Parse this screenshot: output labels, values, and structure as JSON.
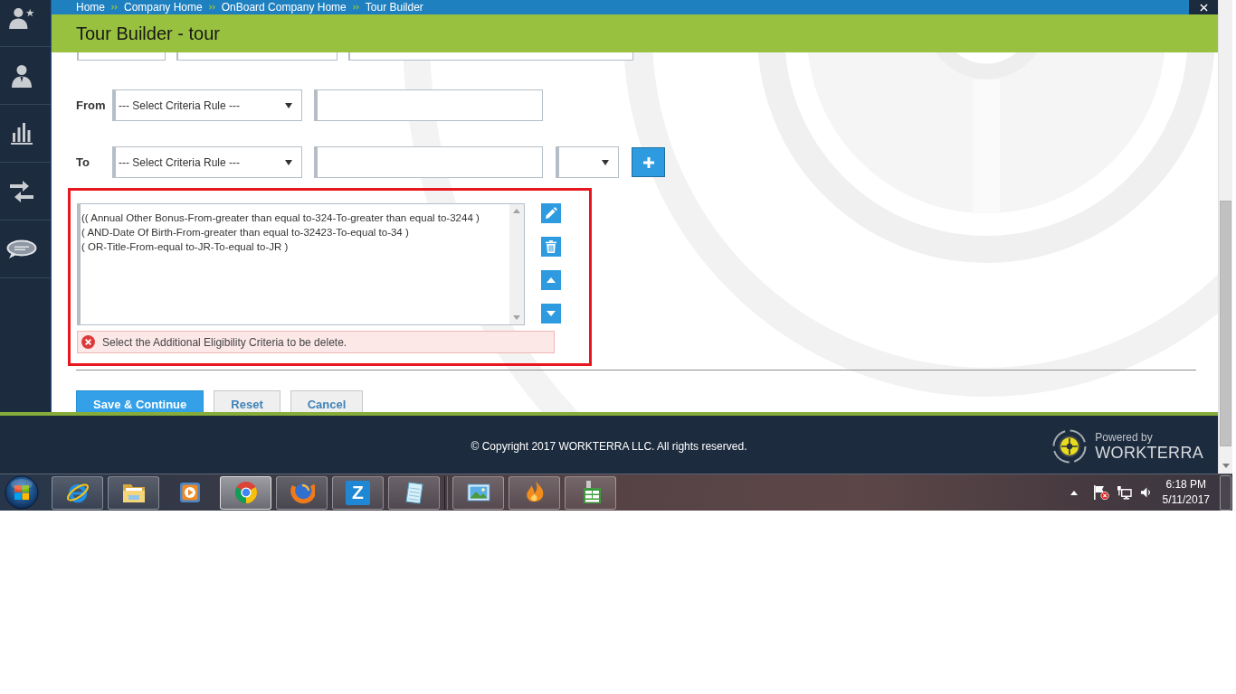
{
  "top_bar": {
    "breadcrumb": [
      "Home",
      "Company Home",
      "OnBoard Company Home",
      "Tour Builder"
    ]
  },
  "page_title": "Tour Builder - tour",
  "from_row": {
    "label": "From",
    "rule_select": "--- Select Criteria Rule ---"
  },
  "to_row": {
    "label": "To",
    "rule_select": "--- Select Criteria Rule ---"
  },
  "criteria_list": [
    {
      "text": "(( Annual Other Bonus-From-greater than equal to-324-To-greater than equal to-3244 )",
      "selected": false
    },
    {
      "text": "( AND-Date Of Birth-From-greater than equal to-32423-To-equal to-34 )",
      "selected": false
    },
    {
      "text": "( OR-Title-From-equal to-JR-To-equal to-JR )",
      "selected": false
    }
  ],
  "error_message": "Select the Additional Eligibility Criteria to be delete.",
  "buttons": [
    {
      "label": "Save & Continue",
      "kind": "primary"
    },
    {
      "label": "Reset",
      "kind": "secondary"
    },
    {
      "label": "Cancel",
      "kind": "secondary"
    }
  ],
  "footer": {
    "copyright": "© Copyright 2017 WORKTERRA LLC. All rights reserved.",
    "powered_by": "Powered by",
    "brand": "WORKTERRA"
  },
  "taskbar": {
    "apps": [
      {
        "running": true,
        "selected": false
      },
      {
        "running": true,
        "selected": false
      },
      {
        "running": false,
        "selected": false
      },
      {
        "running": true,
        "selected": true
      },
      {
        "running": true,
        "selected": false
      },
      {
        "label": "Z",
        "running": true,
        "selected": false
      },
      {
        "running": true,
        "selected": false
      },
      {
        "running": true,
        "selected": false
      },
      {
        "running": true,
        "selected": false
      },
      {
        "running": true,
        "selected": false
      }
    ],
    "clock": {
      "time": "6:18 PM",
      "date": "5/11/2017"
    }
  }
}
